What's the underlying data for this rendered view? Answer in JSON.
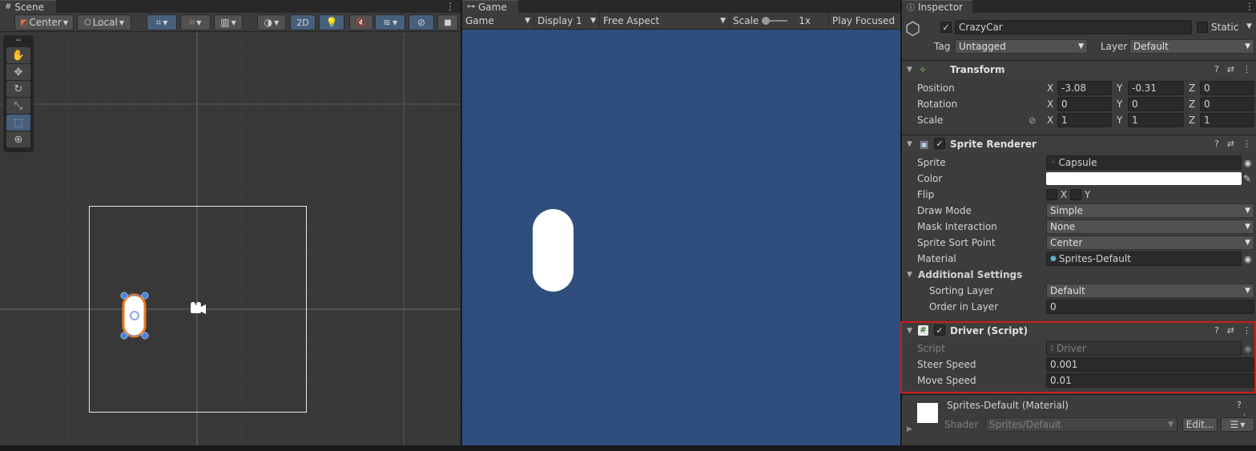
{
  "scene": {
    "tab_label": "Scene",
    "pivot_mode": "Center",
    "pivot_rotation": "Local",
    "mode_2d": "2D"
  },
  "game": {
    "tab_label": "Game",
    "view": "Game",
    "display": "Display 1",
    "aspect": "Free Aspect",
    "scale_label": "Scale",
    "scale_value": "1x",
    "play_mode": "Play Focused"
  },
  "inspector": {
    "tab_label": "Inspector",
    "object_name": "CrazyCar",
    "static_label": "Static",
    "tag_label": "Tag",
    "tag_value": "Untagged",
    "layer_label": "Layer",
    "layer_value": "Default",
    "transform": {
      "title": "Transform",
      "rows": [
        {
          "label": "Position",
          "x": "-3.08",
          "y": "-0.31",
          "z": "0"
        },
        {
          "label": "Rotation",
          "x": "0",
          "y": "0",
          "z": "0"
        },
        {
          "label": "Scale",
          "x": "1",
          "y": "1",
          "z": "1"
        }
      ]
    },
    "axis_labels": {
      "x": "X",
      "y": "Y",
      "z": "Z"
    },
    "sprite_renderer": {
      "title": "Sprite Renderer",
      "sprite_label": "Sprite",
      "sprite_value": "Capsule",
      "color_label": "Color",
      "color_value": "#ffffff",
      "flip_label": "Flip",
      "flip_x": "X",
      "flip_y": "Y",
      "draw_mode_label": "Draw Mode",
      "draw_mode_value": "Simple",
      "mask_label": "Mask Interaction",
      "mask_value": "None",
      "sort_point_label": "Sprite Sort Point",
      "sort_point_value": "Center",
      "material_label": "Material",
      "material_value": "Sprites-Default",
      "additional_label": "Additional Settings",
      "sorting_layer_label": "Sorting Layer",
      "sorting_layer_value": "Default",
      "order_label": "Order in Layer",
      "order_value": "0"
    },
    "driver": {
      "title": "Driver (Script)",
      "script_label": "Script",
      "script_value": "Driver",
      "steer_label": "Steer Speed",
      "steer_value": "0.001",
      "move_label": "Move Speed",
      "move_value": "0.01"
    },
    "material": {
      "title": "Sprites-Default (Material)",
      "shader_label": "Shader",
      "shader_value": "Sprites/Default",
      "edit_label": "Edit..."
    }
  },
  "colors": {
    "game_bg": "#2f4e7d",
    "selection_outline": "#f07818",
    "highlight_box": "#d01a1a"
  }
}
